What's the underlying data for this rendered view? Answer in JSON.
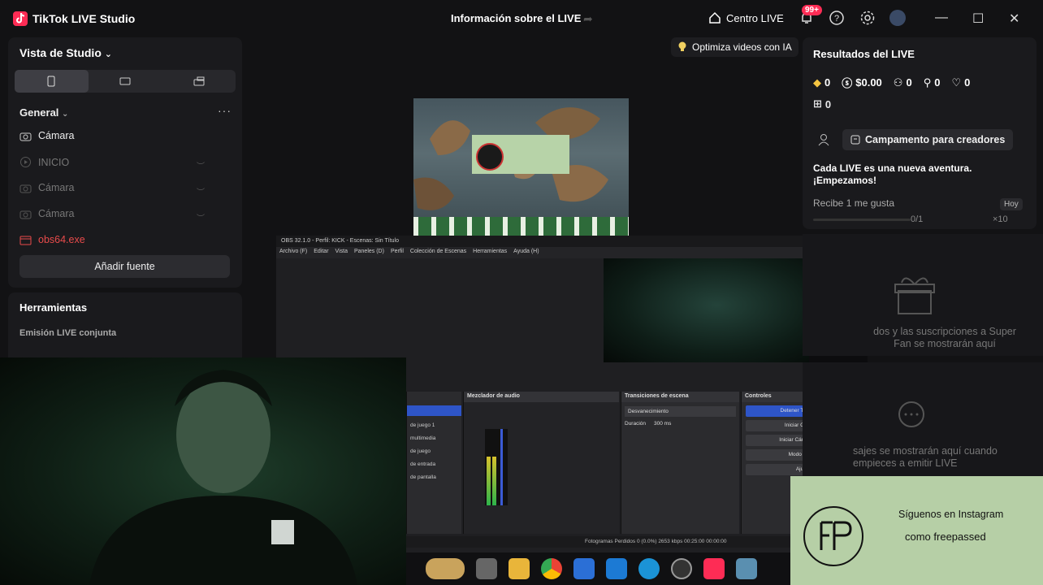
{
  "window": {
    "app_title": "TikTok LIVE Studio",
    "center_title": "Información sobre el LIVE",
    "centro_live": "Centro LIVE",
    "notification_badge": "99+"
  },
  "left": {
    "vista": "Vista de Studio",
    "general": "General",
    "sources": [
      "Cámara",
      "INICIO",
      "Cámara",
      "Cámara",
      "obs64.exe"
    ],
    "add_source": "Añadir fuente",
    "tools_title": "Herramientas",
    "tools_sub": "Emisión LIVE conjunta"
  },
  "center": {
    "optimiza": "Optimiza videos con IA"
  },
  "obs": {
    "title": "OBS 32.1.0 - Perfil: KICK - Escenas: Sin Título",
    "menu": [
      "Archivo (F)",
      "Editar",
      "Vista",
      "Paneles (D)",
      "Perfil",
      "Colección de Escenas",
      "Herramientas",
      "Ayuda (H)"
    ],
    "panels": {
      "mixer": "Mezclador de audio",
      "transitions": "Transiciones de escena",
      "controls": "Controles"
    },
    "transition_value": "Desvanecimiento",
    "duration_label": "Duración",
    "duration_value": "300 ms",
    "controls": [
      "Detener Transmisión",
      "Iniciar Grabación",
      "Iniciar Cámara Virtual",
      "Modo Estudio",
      "Ajustes"
    ],
    "sources": [
      "de juego 1",
      "multimedia",
      "de juego",
      "de entrada",
      "de pantalla"
    ],
    "status": "Fotogramas Perdidos 0 (0.0%)   2653 kbps   00:25:00   00:00:00"
  },
  "right": {
    "title": "Resultados del LIVE",
    "stats": [
      "0",
      "$0.00",
      "0",
      "0",
      "0"
    ],
    "gifts": "0",
    "camp": "Campamento para creadores",
    "adventure": "Cada LIVE es una nueva aventura. ¡Empezamos!",
    "recibe": "Recibe 1 me gusta",
    "hoy": "Hoy",
    "progress": "0/1",
    "progress_fraction": 0,
    "x10": "×10",
    "fan_text": "dos y las suscripciones a Super Fan se mostrarán aquí",
    "msg_text": "sajes se mostrarán aquí cuando empieces a emitir LIVE"
  },
  "overlay": {
    "insta_line1": "Síguenos en Instagram",
    "insta_line2": "como freepassed"
  },
  "colors": {
    "accent": "#fe2c55",
    "obs_primary": "#2e55c8",
    "error": "#e84b4b"
  }
}
